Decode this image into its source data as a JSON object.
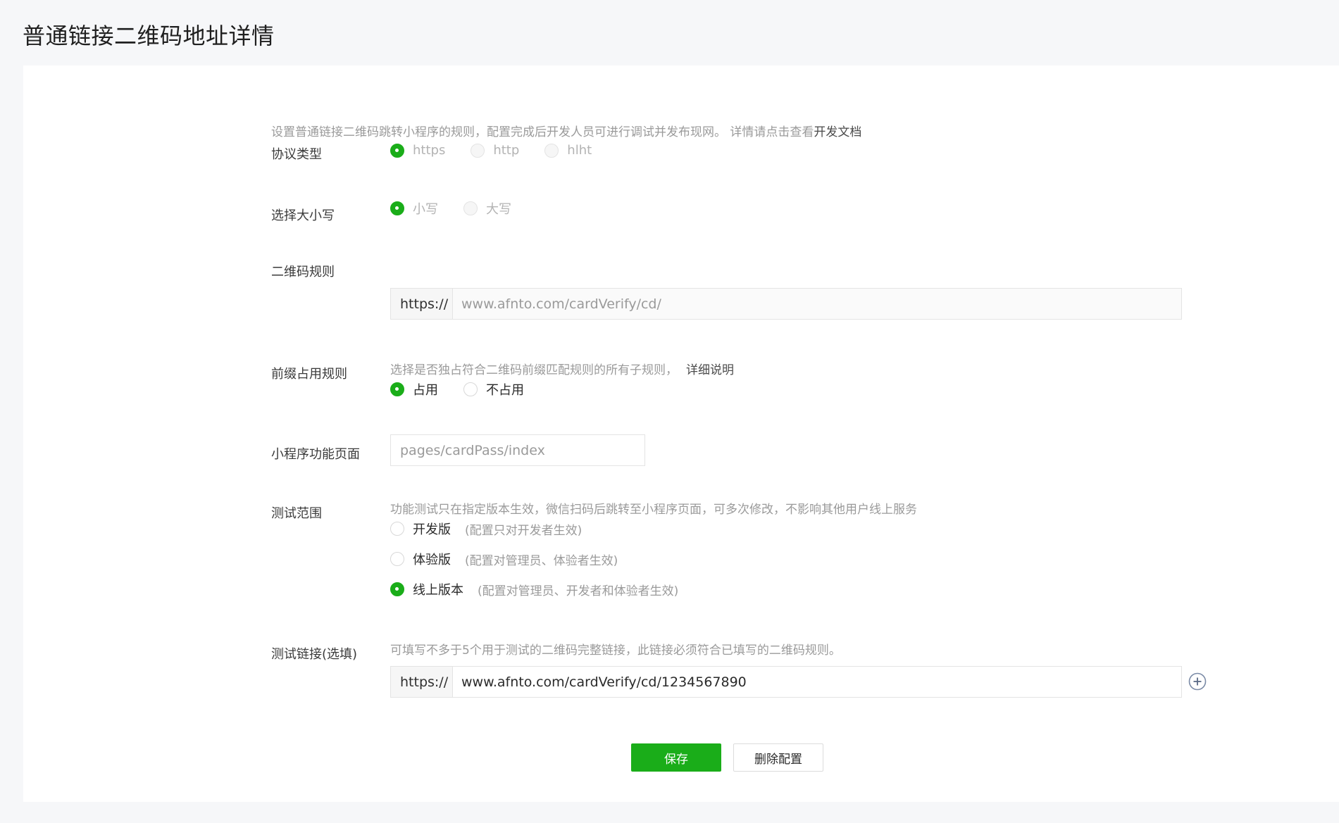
{
  "page": {
    "title": "普通链接二维码地址详情"
  },
  "intro": {
    "text": "设置普通链接二维码跳转小程序的规则，配置完成后开发人员可进行调试并发布现网。 详情请点击查看",
    "link": "开发文档"
  },
  "protocol": {
    "label": "协议类型",
    "options": [
      "https",
      "http",
      "hlht"
    ],
    "selected": "https"
  },
  "case": {
    "label": "选择大小写",
    "options": [
      "小写",
      "大写"
    ],
    "selected": "小写"
  },
  "qr_rule": {
    "label": "二维码规则",
    "prefix": "https://",
    "value": "www.afnto.com/cardVerify/cd/"
  },
  "prefix_rule": {
    "label": "前缀占用规则",
    "hint": "选择是否独占符合二维码前缀匹配规则的所有子规则，",
    "hint_link": "详细说明",
    "options": [
      "占用",
      "不占用"
    ],
    "selected": "占用"
  },
  "page_path": {
    "label": "小程序功能页面",
    "value": "pages/cardPass/index"
  },
  "test_scope": {
    "label": "测试范围",
    "hint": "功能测试只在指定版本生效，微信扫码后跳转至小程序页面，可多次修改，不影响其他用户线上服务",
    "options": [
      {
        "label": "开发版",
        "note": "(配置只对开发者生效)"
      },
      {
        "label": "体验版",
        "note": "(配置对管理员、体验者生效)"
      },
      {
        "label": "线上版本",
        "note": "(配置对管理员、开发者和体验者生效)"
      }
    ],
    "selected": "线上版本"
  },
  "test_link": {
    "label": "测试链接(选填)",
    "hint": "可填写不多于5个用于测试的二维码完整链接，此链接必须符合已填写的二维码规则。",
    "prefix": "https://",
    "value": "www.afnto.com/cardVerify/cd/1234567890"
  },
  "actions": {
    "save": "保存",
    "delete": "删除配置"
  },
  "colors": {
    "accent": "#1aad19"
  }
}
